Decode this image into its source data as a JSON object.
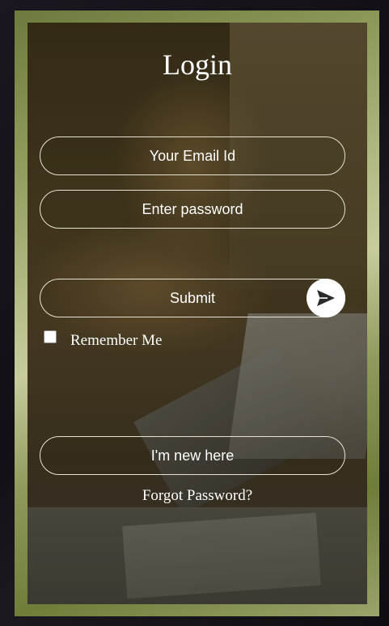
{
  "login": {
    "title": "Login",
    "email_placeholder": "Your Email Id",
    "password_placeholder": "Enter password",
    "submit_label": "Submit",
    "send_icon": "paper-plane-icon",
    "remember_label": "Remember Me",
    "remember_checked": false,
    "new_here_label": "I'm new here",
    "forgot_label": "Forgot Password?"
  },
  "colors": {
    "frame_gradient": [
      "#6d7a3e",
      "#c8cb9c",
      "#6f7d3a"
    ],
    "text": "#ffffff",
    "pill_border": "#e8e2d3"
  }
}
